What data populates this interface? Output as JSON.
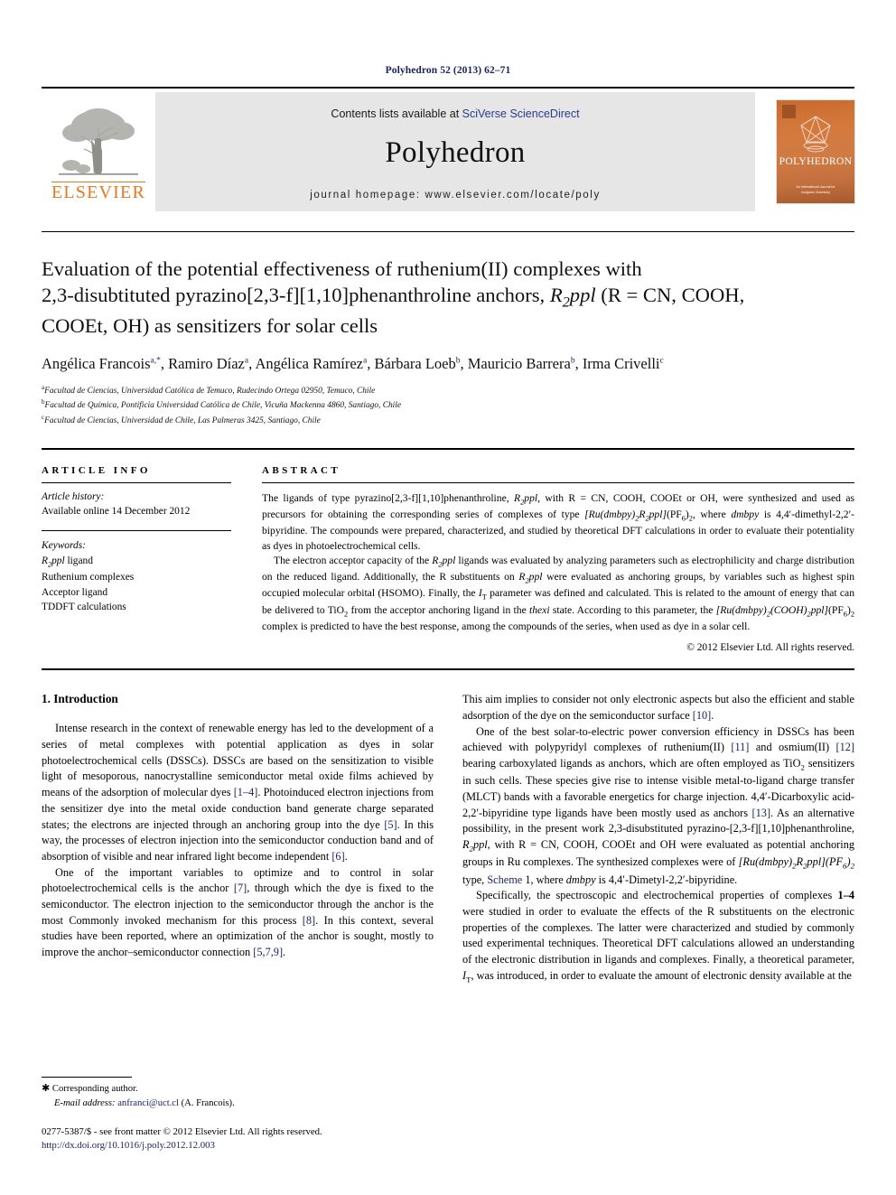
{
  "running_head": "Polyhedron 52 (2013) 62–71",
  "banner": {
    "contents_prefix": "Contents lists available at ",
    "sciencedirect": "SciVerse ScienceDirect",
    "journal_title": "Polyhedron",
    "homepage": "journal homepage: www.elsevier.com/locate/poly",
    "publisher_logo_text": "ELSEVIER",
    "publisher_logo_icon": "elsevier-tree-icon",
    "cover_word": "POLYHEDRON",
    "cover_foot_line1": "An International Journal for",
    "cover_foot_line2": "Inorganic Chemistry",
    "accent_orange": "#E87722",
    "link_blue": "#2b3b8f",
    "header_navy": "#1a2461"
  },
  "article": {
    "title_line1": "Evaluation of the potential effectiveness of ruthenium(II) complexes with",
    "title_line2_a": "2,3-disubtituted pyrazino[2,3-f][1,10]phenanthroline anchors, ",
    "title_line2_r": "R",
    "title_line2_sub": "2",
    "title_line2_ppl": "ppl",
    "title_line2_b": " (R = CN, COOH,",
    "title_line3": "COOEt, OH) as sensitizers for solar cells",
    "authors": [
      {
        "name": "Angélica Francois",
        "marks": "a,*"
      },
      {
        "name": "Ramiro Díaz",
        "marks": "a"
      },
      {
        "name": "Angélica Ramírez",
        "marks": "a"
      },
      {
        "name": "Bárbara Loeb",
        "marks": "b"
      },
      {
        "name": "Mauricio Barrera",
        "marks": "b"
      },
      {
        "name": "Irma Crivelli",
        "marks": "c"
      }
    ],
    "affiliations": [
      {
        "mark": "a",
        "text": "Facultad de Ciencias, Universidad Católica de Temuco, Rudecindo Ortega 02950, Temuco, Chile"
      },
      {
        "mark": "b",
        "text": "Facultad de Química, Pontificia Universidad Católica de Chile, Vicuña Mackenna 4860, Santiago, Chile"
      },
      {
        "mark": "c",
        "text": "Facultad de Ciencias, Universidad de Chile, Las Palmeras 3425, Santiago, Chile"
      }
    ]
  },
  "article_info": {
    "label": "ARTICLE INFO",
    "history_label": "Article history:",
    "history_value": "Available online 14 December 2012",
    "keywords_label": "Keywords:",
    "keywords": [
      "R2ppl ligand",
      "Ruthenium complexes",
      "Acceptor ligand",
      "TDDFT calculations"
    ]
  },
  "abstract": {
    "label": "ABSTRACT",
    "paragraph1": "The ligands of type pyrazino[2,3-f][1,10]phenanthroline, R2ppl, with R = CN, COOH, COOEt or OH, were synthesized and used as precursors for obtaining the corresponding series of complexes of type [Ru(dmbpy)2R2ppl](PF6)2, where dmbpy is 4,4′-dimethyl-2,2′-bipyridine. The compounds were prepared, characterized, and studied by theoretical DFT calculations in order to evaluate their potentiality as dyes in photoelectrochemical cells.",
    "paragraph2": "The electron acceptor capacity of the R2ppl ligands was evaluated by analyzing parameters such as electrophilicity and charge distribution on the reduced ligand. Additionally, the R substituents on R2ppl were evaluated as anchoring groups, by variables such as highest spin occupied molecular orbital (HSOMO). Finally, the IT parameter was defined and calculated. This is related to the amount of energy that can be delivered to TiO2 from the acceptor anchoring ligand in the thexi state. According to this parameter, the [Ru(dmbpy)2(COOH)2ppl](PF6)2 complex is predicted to have the best response, among the compounds of the series, when used as dye in a solar cell.",
    "copyright": "© 2012 Elsevier Ltd. All rights reserved."
  },
  "body": {
    "section_heading": "1. Introduction",
    "left_paragraph1": "Intense research in the context of renewable energy has led to the development of a series of metal complexes with potential application as dyes in solar photoelectrochemical cells (DSSCs). DSSCs are based on the sensitization to visible light of mesoporous, nanocrystalline semiconductor metal oxide films achieved by means of the adsorption of molecular dyes [1–4]. Photoinduced electron injections from the sensitizer dye into the metal oxide conduction band generate charge separated states; the electrons are injected through an anchoring group into the dye [5]. In this way, the processes of electron injection into the semiconductor conduction band and of absorption of visible and near infrared light become independent [6].",
    "left_paragraph2": "One of the important variables to optimize and to control in solar photoelectrochemical cells is the anchor [7], through which the dye is fixed to the semiconductor. The electron injection to the semiconductor through the anchor is the most Commonly invoked mechanism for this process [8]. In this context, several studies have been reported, where an optimization of the anchor is sought, mostly to improve the anchor–semiconductor connection [5,7,9].",
    "right_paragraph1": "This aim implies to consider not only electronic aspects but also the efficient and stable adsorption of the dye on the semiconductor surface [10].",
    "right_paragraph2": "One of the best solar-to-electric power conversion efficiency in DSSCs has been achieved with polypyridyl complexes of ruthenium(II) [11] and osmium(II) [12] bearing carboxylated ligands as anchors, which are often employed as TiO2 sensitizers in such cells. These species give rise to intense visible metal-to-ligand charge transfer (MLCT) bands with a favorable energetics for charge injection. 4,4′-Dicarboxylic acid-2,2′-bipyridine type ligands have been mostly used as anchors [13]. As an alternative possibility, in the present work 2,3-disubstituted pyrazino-[2,3-f][1,10]phenanthroline, R2ppl, with R = CN, COOH, COOEt and OH were evaluated as potential anchoring groups in Ru complexes. The synthesized complexes were of [Ru(dmbpy)2R2ppl](PF6)2 type, Scheme 1, where dmbpy is 4,4′-Dimetyl-2,2′-bipyridine.",
    "right_paragraph3": "Specifically, the spectroscopic and electrochemical properties of complexes 1–4 were studied in order to evaluate the effects of the R substituents on the electronic properties of the complexes. The latter were characterized and studied by commonly used experimental techniques. Theoretical DFT calculations allowed an understanding of the electronic distribution in ligands and complexes. Finally, a theoretical parameter, IT, was introduced, in order to evaluate the amount of electronic density available at the"
  },
  "footnote": {
    "corresponding": "Corresponding author.",
    "email_label": "E-mail address:",
    "email": "anfranci@uct.cl",
    "email_owner": "(A. Francois).",
    "issn_line": "0277-5387/$ - see front matter © 2012 Elsevier Ltd. All rights reserved.",
    "doi": "http://dx.doi.org/10.1016/j.poly.2012.12.003"
  }
}
